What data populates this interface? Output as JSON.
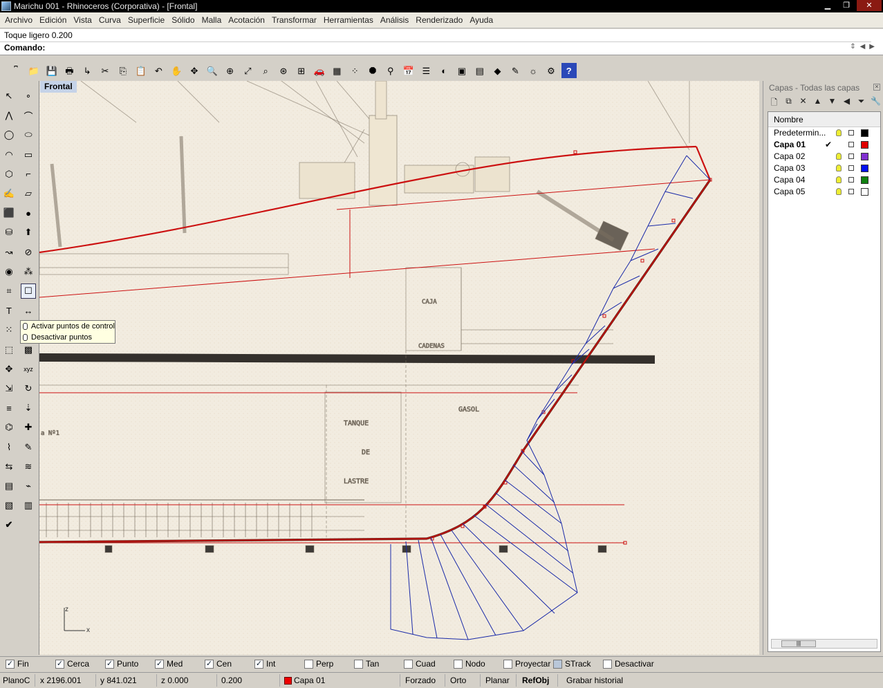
{
  "window": {
    "title": "Marichu 001 - Rhinoceros (Corporativa) - [Frontal]",
    "buttons": [
      "▁",
      "❐",
      "✕"
    ]
  },
  "menu": [
    "Archivo",
    "Edición",
    "Vista",
    "Curva",
    "Superficie",
    "Sólido",
    "Malla",
    "Acotación",
    "Transformar",
    "Herramientas",
    "Análisis",
    "Renderizado",
    "Ayuda"
  ],
  "command": {
    "history": "Toque ligero 0.200",
    "prompt": "Comando:",
    "value": ""
  },
  "viewport": {
    "name": "Frontal",
    "axis_z": "z",
    "axis_x": "x"
  },
  "tooltip": {
    "line1": "Activar puntos de control",
    "line2": "Desactivar puntos"
  },
  "layers": {
    "title": "Capas - Todas las capas",
    "column_header": "Nombre",
    "items": [
      {
        "name": "Predetermin...",
        "current": false,
        "color": "#000000"
      },
      {
        "name": "Capa 01",
        "current": true,
        "color": "#e00000"
      },
      {
        "name": "Capa 02",
        "current": false,
        "color": "#8030d0"
      },
      {
        "name": "Capa 03",
        "current": false,
        "color": "#0010f0"
      },
      {
        "name": "Capa 04",
        "current": false,
        "color": "#108010"
      },
      {
        "name": "Capa 05",
        "current": false,
        "color": "#ffffff"
      }
    ],
    "current_mark": "✔"
  },
  "osnaps": [
    {
      "label": "Fin",
      "checked": true
    },
    {
      "label": "Cerca",
      "checked": true
    },
    {
      "label": "Punto",
      "checked": true
    },
    {
      "label": "Med",
      "checked": true
    },
    {
      "label": "Cen",
      "checked": true
    },
    {
      "label": "Int",
      "checked": true
    },
    {
      "label": "Perp",
      "checked": false
    },
    {
      "label": "Tan",
      "checked": false
    },
    {
      "label": "Cuad",
      "checked": false
    },
    {
      "label": "Nodo",
      "checked": false
    },
    {
      "label": "Proyectar",
      "checked": false
    },
    {
      "label": "STrack",
      "checked": false
    },
    {
      "label": "Desactivar",
      "checked": false
    }
  ],
  "status": {
    "plane": "PlanoC",
    "x": "x 2196.001",
    "y": "y 841.021",
    "z": "z 0.000",
    "distance": "0.200",
    "layer": "Capa 01",
    "forzado": "Forzado",
    "orto": "Orto",
    "planar": "Planar",
    "refobj": "RefObj",
    "history": "Grabar historial"
  },
  "colors": {
    "curve_red": "#cc1111",
    "curvature_blue": "#1a2aa8",
    "viewport_bg": "#f2ece0"
  },
  "toolbar_top_icons": [
    "new-icon",
    "open-icon",
    "save-icon",
    "print-icon",
    "import-icon",
    "cut-icon",
    "copy-icon",
    "paste-icon",
    "undo-icon",
    "pan-icon",
    "rotate-view-icon",
    "zoom-icon",
    "zoom-window-icon",
    "zoom-extents-icon",
    "zoom-selected-icon",
    "zoom-dynamic-icon",
    "4-view-icon",
    "car-icon",
    "grid-icon",
    "points-icon",
    "filter-icon",
    "lamp-icon",
    "calendar-icon",
    "layers-icon",
    "color-icon",
    "wireframe-icon",
    "shaded-icon",
    "render-icon",
    "pencil-icon",
    "light-icon",
    "options-icon",
    "help-icon"
  ],
  "toolbar_left_icons": [
    "select-icon",
    "point-icon",
    "polyline-icon",
    "curve-icon",
    "circle-icon",
    "ellipse-icon",
    "arc-icon",
    "rectangle-icon",
    "polygon-icon",
    "fillet-icon",
    "freeform-icon",
    "surface-icon",
    "box-icon",
    "sphere-icon",
    "cylinder-icon",
    "extrude-icon",
    "sweep-icon",
    "split-icon",
    "boolean-icon",
    "group-icon",
    "cage-icon",
    "control-points-icon",
    "text-icon",
    "dimension-icon",
    "array-icon",
    "explode-icon",
    "block-icon",
    "mesh-icon",
    "move-icon",
    "xyz-icon",
    "scale-icon",
    "orient-icon",
    "align-icon",
    "project-icon",
    "analyze-icon",
    "snap-icon",
    "wire-icon",
    "sketch-icon",
    "mirror-icon",
    "zebra-icon",
    "layout-icon",
    "curvature-icon",
    "render-color-icon",
    "layout2-icon",
    "ok-icon"
  ]
}
